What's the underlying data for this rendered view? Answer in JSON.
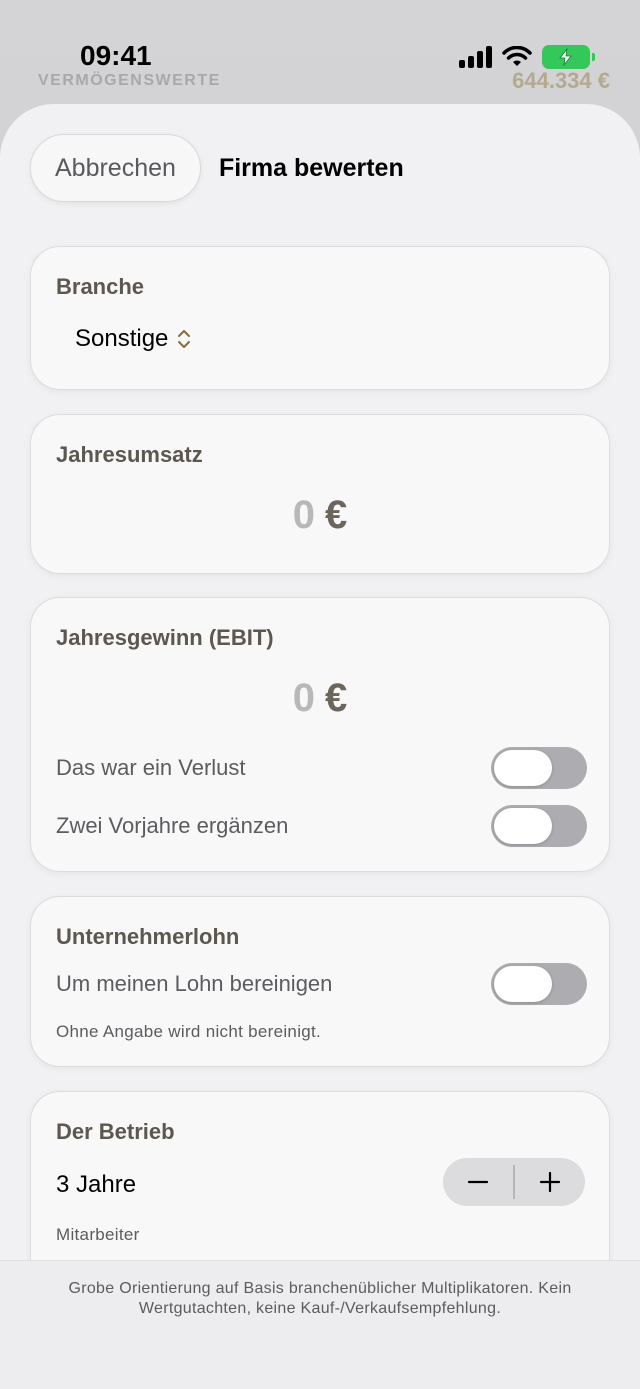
{
  "status_bar": {
    "time": "09:41"
  },
  "background": {
    "label": "VERMÖGENSWERTE",
    "amount": "644.334 €"
  },
  "header": {
    "cancel_label": "Abbrechen",
    "title": "Firma bewerten"
  },
  "branche": {
    "title": "Branche",
    "value": "Sonstige"
  },
  "jahresumsatz": {
    "title": "Jahresumsatz",
    "amount": "0",
    "currency": "€"
  },
  "jahresgewinn": {
    "title": "Jahresgewinn (EBIT)",
    "amount": "0",
    "currency": "€",
    "loss_label": "Das war ein Verlust",
    "loss_on": false,
    "prior_years_label": "Zwei Vorjahre ergänzen",
    "prior_years_on": false
  },
  "unternehmerlohn": {
    "title": "Unternehmerlohn",
    "adjust_label": "Um meinen Lohn bereinigen",
    "adjust_on": false,
    "note": "Ohne Angabe wird nicht bereinigt."
  },
  "betrieb": {
    "title": "Der Betrieb",
    "years_value": "3 Jahre",
    "employees_label": "Mitarbeiter"
  },
  "footer": {
    "disclaimer": "Grobe Orientierung auf Basis branchenüblicher Multiplikatoren. Kein Wertgutachten, keine Kauf-/Verkaufsempfehlung."
  },
  "colors": {
    "accent_brown": "#6b655c",
    "toggle_off": "#adadb1",
    "battery_green": "#34c759"
  }
}
